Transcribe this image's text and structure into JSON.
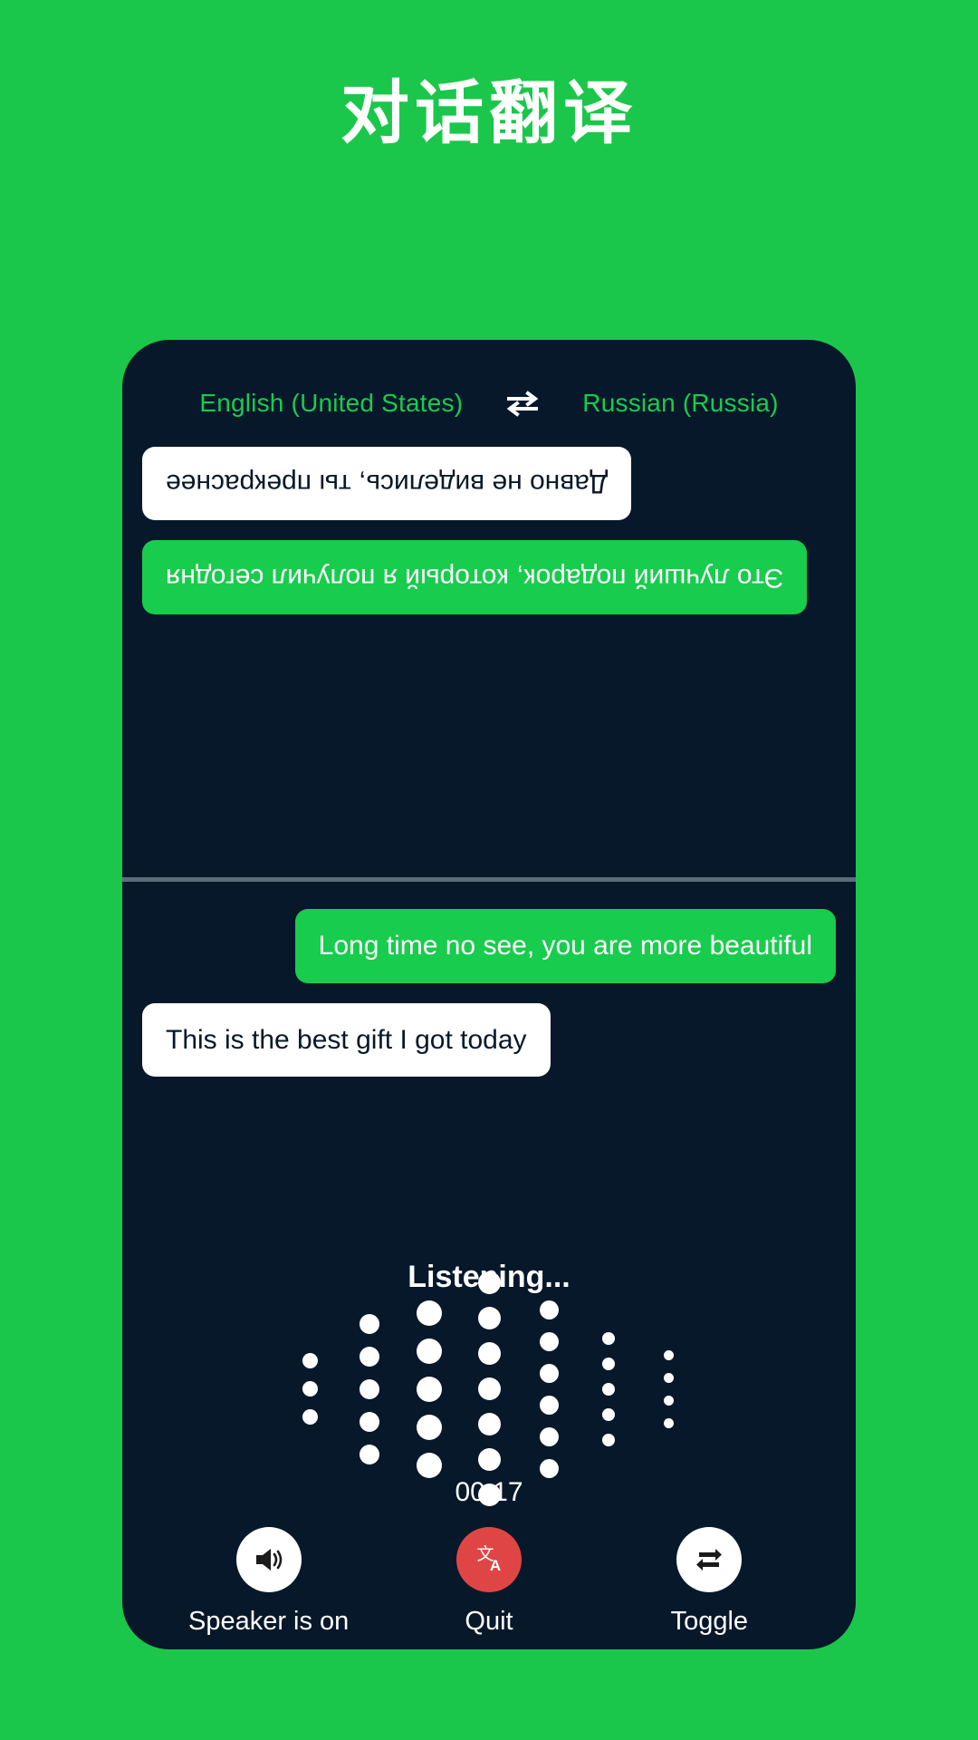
{
  "page": {
    "title": "对话翻译",
    "background_color": "#1bc74a",
    "panel_color": "#08182b",
    "accent_green": "#18cc4d",
    "quit_red": "#e04545"
  },
  "language_bar": {
    "source_language": "English (United States)",
    "target_language": "Russian (Russia)",
    "swap_icon": "swap-horizontal-icon"
  },
  "conversation": {
    "top_panel_rotated": true,
    "top_messages": [
      {
        "text": "Это лучший подарок, который я получил сегодня",
        "style": "green",
        "align": "right"
      },
      {
        "text": "Давно не виделись, ты прекраснее",
        "style": "white",
        "align": "right"
      }
    ],
    "bottom_messages": [
      {
        "text": "Long time no see, you are more beautiful",
        "style": "green",
        "align": "right"
      },
      {
        "text": "This is the best gift I got today",
        "style": "white",
        "align": "left"
      }
    ]
  },
  "status": {
    "listening_label": "Listening...",
    "timer": "00:17"
  },
  "waveform": {
    "columns": [
      {
        "dots": 3,
        "size": 17
      },
      {
        "dots": 5,
        "size": 22
      },
      {
        "dots": 5,
        "size": 28
      },
      {
        "dots": 7,
        "size": 25
      },
      {
        "dots": 6,
        "size": 21
      },
      {
        "dots": 5,
        "size": 14
      },
      {
        "dots": 4,
        "size": 11
      }
    ],
    "gap": 14,
    "color": "#ffffff"
  },
  "controls": [
    {
      "label": "Speaker is on",
      "icon": "speaker-on-icon",
      "style": "white"
    },
    {
      "label": "Quit",
      "icon": "translate-icon",
      "style": "red"
    },
    {
      "label": "Toggle",
      "icon": "toggle-swap-icon",
      "style": "white"
    }
  ]
}
